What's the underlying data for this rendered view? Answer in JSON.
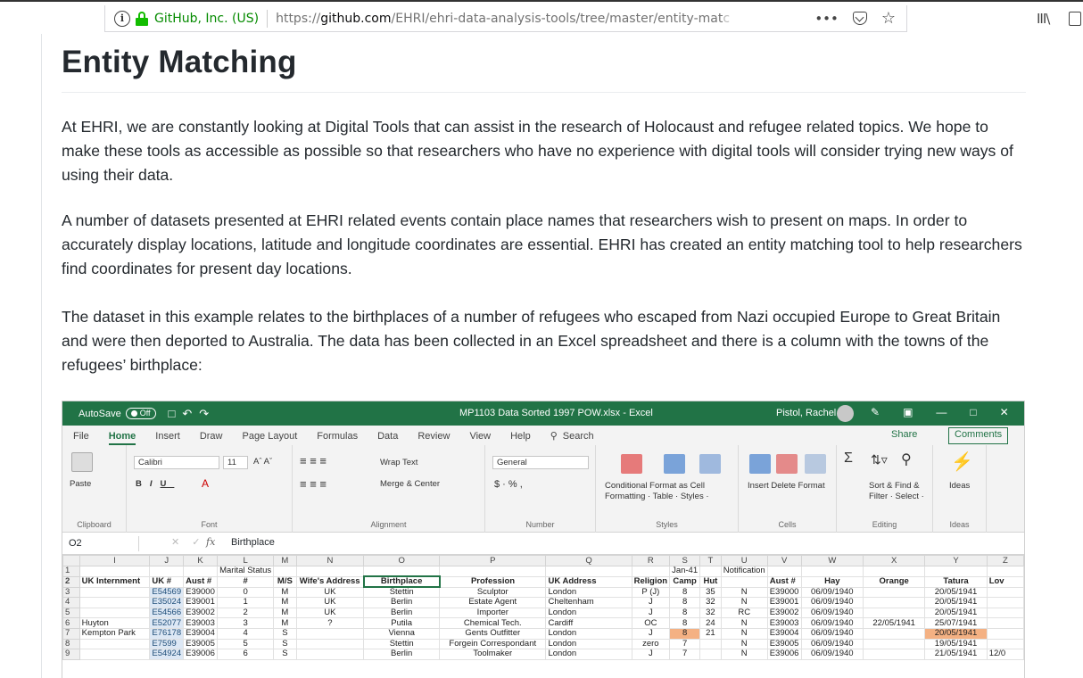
{
  "browser": {
    "identity_org": "GitHub, Inc. (US)",
    "url_prefix": "https://",
    "url_host": "github.com",
    "url_path": "/EHRI/ehri-data-analysis-tools/tree/master/entity-mat",
    "url_fade": "c",
    "more_glyph": "•••",
    "star_glyph": "☆",
    "library_glyph": "III\\"
  },
  "page": {
    "title": "Entity Matching",
    "paragraphs": [
      "At EHRI, we are constantly looking at Digital Tools that can assist in the research of Holocaust and refugee related topics. We hope to make these tools as accessible as possible so that researchers who have no experience with digital tools will consider trying new ways of using their data.",
      "A number of datasets presented at EHRI related events contain place names that researchers wish to present on maps. In order to accurately display locations, latitude and longitude coordinates are essential. EHRI has created an entity matching tool to help researchers find coordinates for present day locations.",
      "The dataset in this example relates to the birthplaces of a number of refugees who escaped from Nazi occupied Europe to Great Britain and were then deported to Australia. The data has been collected in an Excel spreadsheet and there is a column with the towns of the refugees’ birthplace:"
    ]
  },
  "excel": {
    "autosave": "AutoSave",
    "autosave_state": "Off",
    "filename": "MP1103 Data Sorted 1997 POW.xlsx  -  Excel",
    "user": "Pistol, Rachel",
    "tabs": [
      "File",
      "Home",
      "Insert",
      "Draw",
      "Page Layout",
      "Formulas",
      "Data",
      "Review",
      "View",
      "Help"
    ],
    "search": "Search",
    "share": "Share",
    "comments": "Comments",
    "ribbon": {
      "clipboard": "Clipboard",
      "paste": "Paste",
      "font_name": "Calibri",
      "font_size": "11",
      "font": "Font",
      "wrap_text": "Wrap Text",
      "merge_center": "Merge & Center",
      "alignment": "Alignment",
      "number_format": "General",
      "number": "Number",
      "conditional": "Conditional\nFormatting",
      "format_as_table": "Format as\nTable",
      "cell_styles": "Cell\nStyles",
      "styles": "Styles",
      "insert": "Insert",
      "delete": "Delete",
      "format": "Format",
      "cells": "Cells",
      "sort_filter": "Sort &\nFilter",
      "find_select": "Find &\nSelect",
      "editing": "Editing",
      "ideas": "Ideas",
      "ideas_group": "Ideas"
    },
    "name_box": "O2",
    "formula": "Birthplace",
    "columns": [
      "",
      "I",
      "J",
      "K",
      "L",
      "M",
      "N",
      "O",
      "P",
      "Q",
      "R",
      "S",
      "T",
      "U",
      "V",
      "W",
      "X",
      "Y",
      "Z"
    ],
    "rows": [
      [
        "1",
        "",
        "",
        "",
        "Marital Status",
        "",
        "",
        "",
        "",
        "",
        "",
        "Jan-41",
        "",
        "Notification",
        "",
        "",
        "",
        "",
        ""
      ],
      [
        "2",
        "UK Internment",
        "UK #",
        "Aust #",
        "#",
        "M/S",
        "Wife's Address",
        "Birthplace",
        "Profession",
        "UK Address",
        "Religion",
        "Camp",
        "Hut",
        "",
        "Aust #",
        "Hay",
        "Orange",
        "Tatura",
        "Lov"
      ],
      [
        "3",
        "",
        "E54569",
        "E39000",
        "0",
        "M",
        "UK",
        "Stettin",
        "Sculptor",
        "London",
        "P (J)",
        "8",
        "35",
        "N",
        "E39000",
        "06/09/1940",
        "",
        "20/05/1941",
        ""
      ],
      [
        "4",
        "",
        "E35024",
        "E39001",
        "1",
        "M",
        "UK",
        "Berlin",
        "Estate Agent",
        "Cheltenham",
        "J",
        "8",
        "32",
        "N",
        "E39001",
        "06/09/1940",
        "",
        "20/05/1941",
        ""
      ],
      [
        "5",
        "",
        "E54566",
        "E39002",
        "2",
        "M",
        "UK",
        "Berlin",
        "Importer",
        "London",
        "J",
        "8",
        "32",
        "RC",
        "E39002",
        "06/09/1940",
        "",
        "20/05/1941",
        ""
      ],
      [
        "6",
        "Huyton",
        "E52077",
        "E39003",
        "3",
        "M",
        "?",
        "Putila",
        "Chemical Tech.",
        "Cardiff",
        "OC",
        "8",
        "24",
        "N",
        "E39003",
        "06/09/1940",
        "22/05/1941",
        "25/07/1941",
        ""
      ],
      [
        "7",
        "Kempton Park",
        "E76178",
        "E39004",
        "4",
        "S",
        "",
        "Vienna",
        "Gents Outfitter",
        "London",
        "J",
        "8",
        "21",
        "N",
        "E39004",
        "06/09/1940",
        "",
        "20/05/1941",
        ""
      ],
      [
        "8",
        "",
        "E7599",
        "E39005",
        "5",
        "S",
        "",
        "Stettin",
        "Forgein Correspondant",
        "London",
        "zero",
        "7",
        "",
        "N",
        "E39005",
        "06/09/1940",
        "",
        "19/05/1941",
        ""
      ],
      [
        "9",
        "",
        "E54924",
        "E39006",
        "6",
        "S",
        "",
        "Berlin",
        "Toolmaker",
        "London",
        "J",
        "7",
        "",
        "N",
        "E39006",
        "06/09/1940",
        "",
        "21/05/1941",
        "12/0"
      ]
    ],
    "colors": {
      "title_green": "#217346",
      "highlight_orange": "#f4b183",
      "id_blue": "#dde8f5"
    }
  }
}
